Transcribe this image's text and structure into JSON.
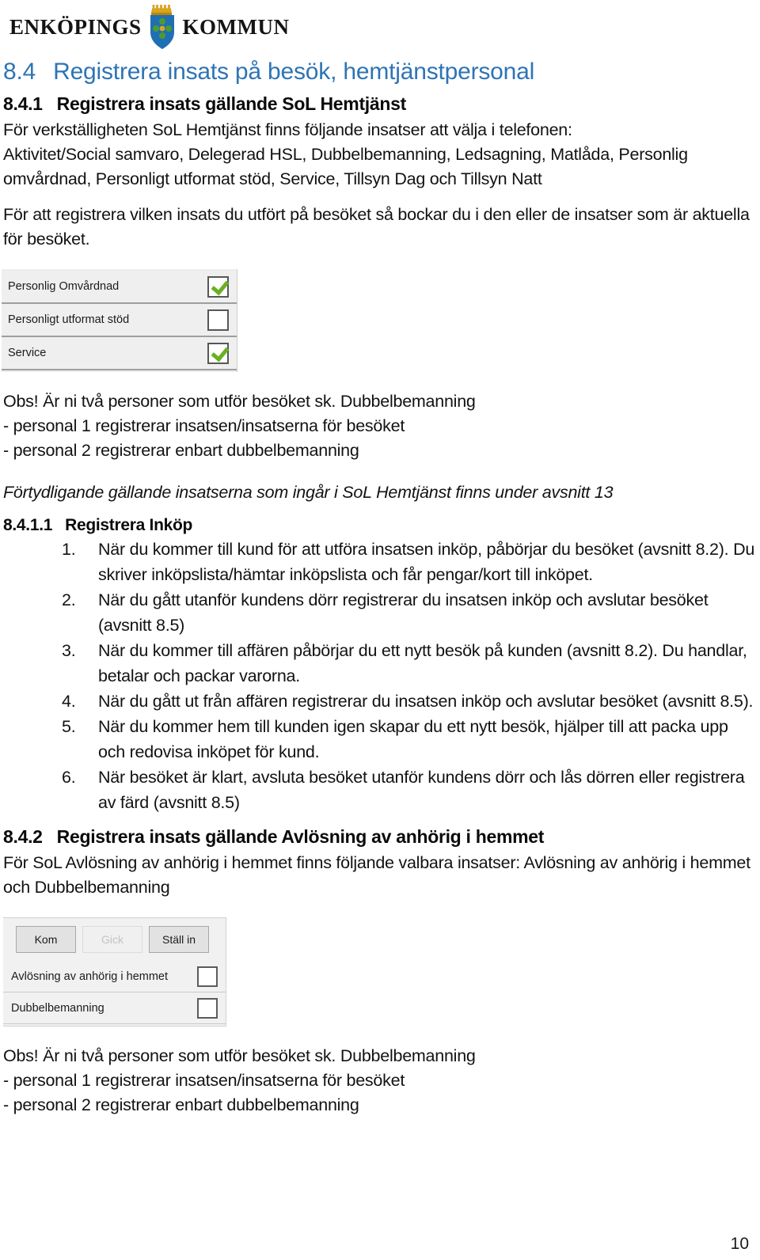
{
  "logo": {
    "word_left": "ENKÖPINGS",
    "word_right": "KOMMUN",
    "crest_name": "enkopings-kommun-coat-of-arms",
    "colors": {
      "shield_blue": "#1f6fb5",
      "crown_gold": "#d9a520",
      "leaf_green": "#4c9b2f"
    }
  },
  "headings": {
    "h1_number": "8.4",
    "h1_text": "Registrera insats på besök, hemtjänstpersonal",
    "h1_color": "#2E74B5",
    "h2_number": "8.4.1",
    "h2_text": "Registrera insats gällande SoL Hemtjänst",
    "h3_number": "8.4.1.1",
    "h3_text": "Registrera Inköp",
    "h4_number": "8.4.2",
    "h4_text": "Registrera insats gällande Avlösning av anhörig i hemmet"
  },
  "intro": {
    "line1": "För verkställigheten SoL Hemtjänst finns följande insatser att välja i telefonen:",
    "line2": "Aktivitet/Social samvaro, Delegerad HSL, Dubbelbemanning, Ledsagning, Matlåda, Personlig omvårdnad, Personligt utformat stöd, Service, Tillsyn Dag och Tillsyn Natt",
    "line3": "För att registrera vilken insats du utfört på besöket så bockar du i den eller de insatser som är aktuella för besöket."
  },
  "screenshot_insatser": {
    "name": "insats-checkbox-list",
    "rows": [
      {
        "label": "Personlig Omvårdnad",
        "checked": true
      },
      {
        "label": "Personligt utformat stöd",
        "checked": false
      },
      {
        "label": "Service",
        "checked": true
      }
    ]
  },
  "obs_block": {
    "line1": "Obs! Är ni två personer som utför besöket sk. Dubbelbemanning",
    "line2": "- personal 1 registrerar insatsen/insatserna för besöket",
    "line3": "- personal 2 registrerar enbart dubbelbemanning"
  },
  "clarification": "Förtydligande gällande insatserna som ingår i SoL Hemtjänst finns under avsnitt 13",
  "steps": [
    "När du kommer till kund för att utföra insatsen inköp, påbörjar du besöket (avsnitt 8.2). Du skriver inköpslista/hämtar inköpslista och får pengar/kort till inköpet.",
    "När du gått utanför kundens dörr registrerar du insatsen inköp och avslutar besöket  (avsnitt 8.5)",
    "När du kommer till affären påbörjar du ett nytt besök på kunden (avsnitt 8.2). Du handlar, betalar och packar varorna.",
    "När du gått ut från affären registrerar du insatsen inköp och avslutar besöket (avsnitt 8.5).",
    "När du kommer hem till kunden igen skapar du ett nytt besök, hjälper till att packa upp och redovisa inköpet för kund.",
    "När besöket är klart, avsluta besöket utanför kundens dörr och lås dörren eller registrera av färd (avsnitt 8.5)"
  ],
  "avlosning_intro": "För SoL Avlösning av anhörig i hemmet finns följande valbara insatser: Avlösning av anhörig i hemmet och Dubbelbemanning",
  "screenshot_avlosning": {
    "name": "avlosning-checkbox-list",
    "buttons": [
      {
        "label": "Kom",
        "disabled": false
      },
      {
        "label": "Gick",
        "disabled": true
      },
      {
        "label": "Ställ in",
        "disabled": false
      }
    ],
    "rows": [
      {
        "label": "Avlösning av anhörig i hemmet",
        "checked": false
      },
      {
        "label": "Dubbelbemanning",
        "checked": false
      }
    ]
  },
  "footer": {
    "page_number": "10"
  }
}
